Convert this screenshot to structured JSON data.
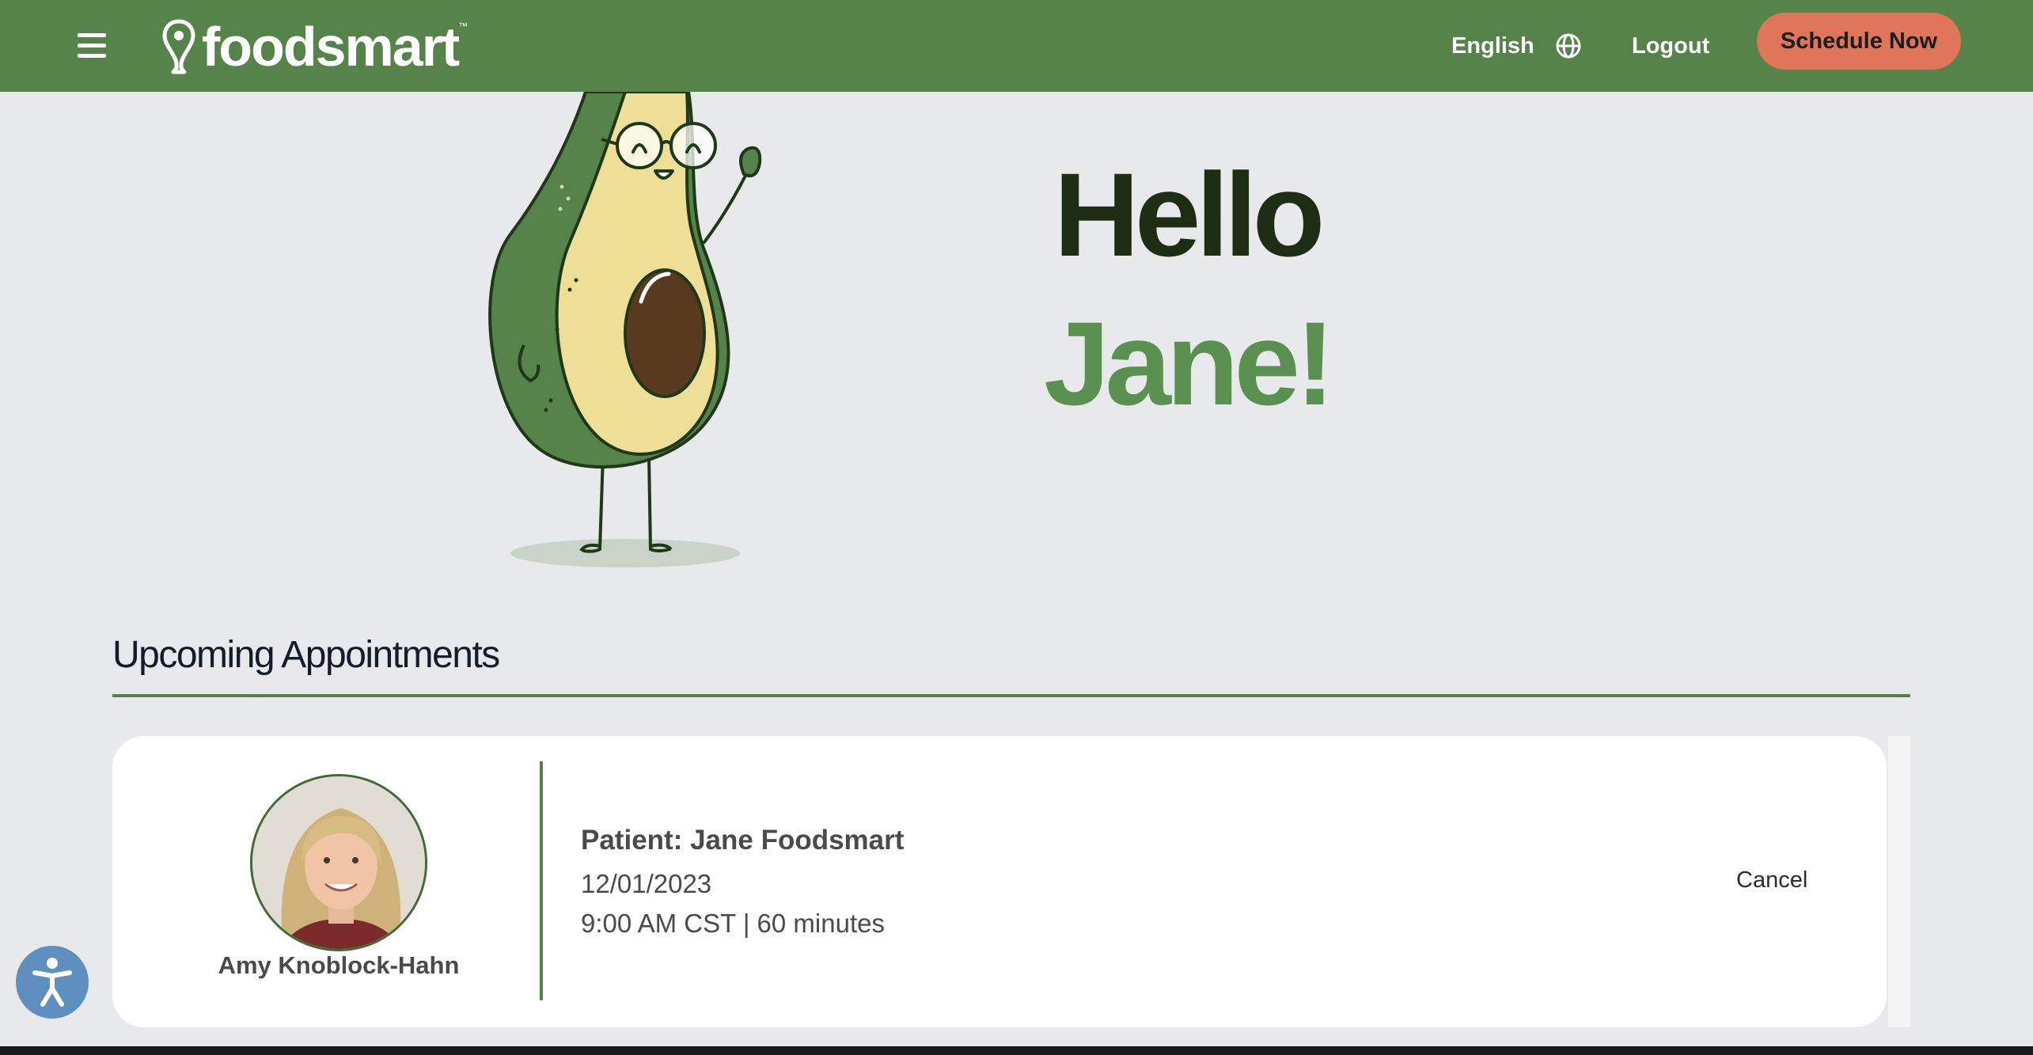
{
  "header": {
    "brand": "foodsmart",
    "brand_tm": "™",
    "language_label": "English",
    "logout_label": "Logout",
    "schedule_label": "Schedule Now",
    "bg_color": "#558349",
    "accent_color": "#df7659"
  },
  "hero": {
    "greeting": "Hello",
    "name": "Jane!"
  },
  "appointments": {
    "section_title": "Upcoming Appointments",
    "items": [
      {
        "coach_name": "Amy Knoblock-Hahn",
        "patient_line": "Patient: Jane Foodsmart",
        "date": "12/01/2023",
        "time_line": "9:00 AM CST | 60 minutes",
        "cancel_label": "Cancel"
      }
    ]
  },
  "icons": [
    "hamburger-menu-icon",
    "location-pin-icon",
    "globe-icon",
    "avocado-mascot-illustration",
    "accessibility-icon"
  ]
}
